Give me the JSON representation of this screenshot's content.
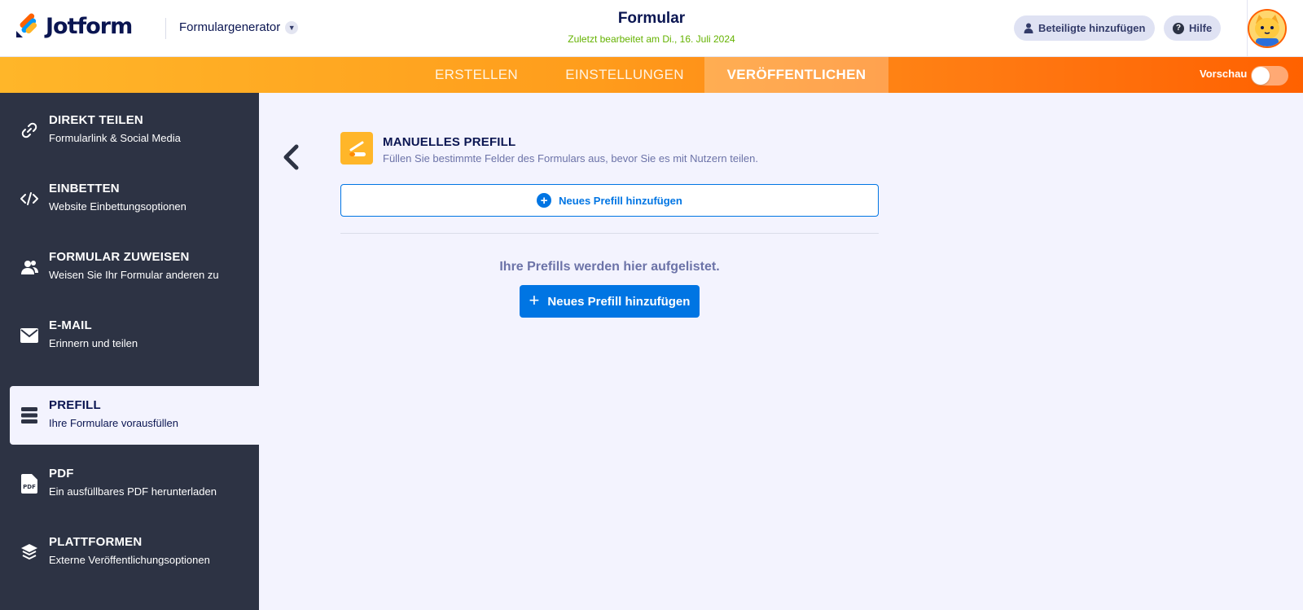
{
  "header": {
    "logo_text": "Jotform",
    "form_builder_label": "Formulargenerator",
    "title": "Formular",
    "last_edited": "Zuletzt bearbeitet am Di., 16. Juli 2024",
    "add_participants_label": "Beteiligte hinzufügen",
    "help_label": "Hilfe"
  },
  "nav": {
    "tabs": [
      {
        "label": "ERSTELLEN"
      },
      {
        "label": "EINSTELLUNGEN"
      },
      {
        "label": "VERÖFFENTLICHEN",
        "active": true
      }
    ],
    "preview_label": "Vorschau",
    "preview_on": false
  },
  "sidebar": {
    "items": [
      {
        "title": "DIREKT TEILEN",
        "desc": "Formularlink & Social Media",
        "icon": "link-icon"
      },
      {
        "title": "EINBETTEN",
        "desc": "Website Einbettungsoptionen",
        "icon": "code-icon"
      },
      {
        "title": "FORMULAR ZUWEISEN",
        "desc": "Weisen Sie Ihr Formular anderen zu",
        "icon": "users-icon"
      },
      {
        "title": "E-MAIL",
        "desc": "Erinnern und teilen",
        "icon": "envelope-icon"
      },
      {
        "title": "PREFILL",
        "desc": "Ihre Formulare vorausfüllen",
        "icon": "prefill-icon",
        "active": true
      },
      {
        "title": "PDF",
        "desc": "Ein ausfüllbares PDF herunterladen",
        "icon": "pdf-icon"
      },
      {
        "title": "PLATTFORMEN",
        "desc": "Externe Veröffentlichungsoptionen",
        "icon": "layers-icon"
      }
    ]
  },
  "main": {
    "section_title": "MANUELLES PREFILL",
    "section_desc": "Füllen Sie bestimmte Felder des Formulars aus, bevor Sie es mit Nutzern teilen.",
    "add_prefill_outline_label": "Neues Prefill hinzufügen",
    "empty_text": "Ihre Prefills werden hier aufgelistet.",
    "add_prefill_primary_label": "Neues Prefill hinzufügen"
  },
  "colors": {
    "orange": "#ff6100",
    "accent_yellow": "#ffb629",
    "primary_blue": "#0075e3",
    "sidebar_bg": "#2d3344",
    "navy": "#0a1551",
    "green": "#64b200"
  }
}
